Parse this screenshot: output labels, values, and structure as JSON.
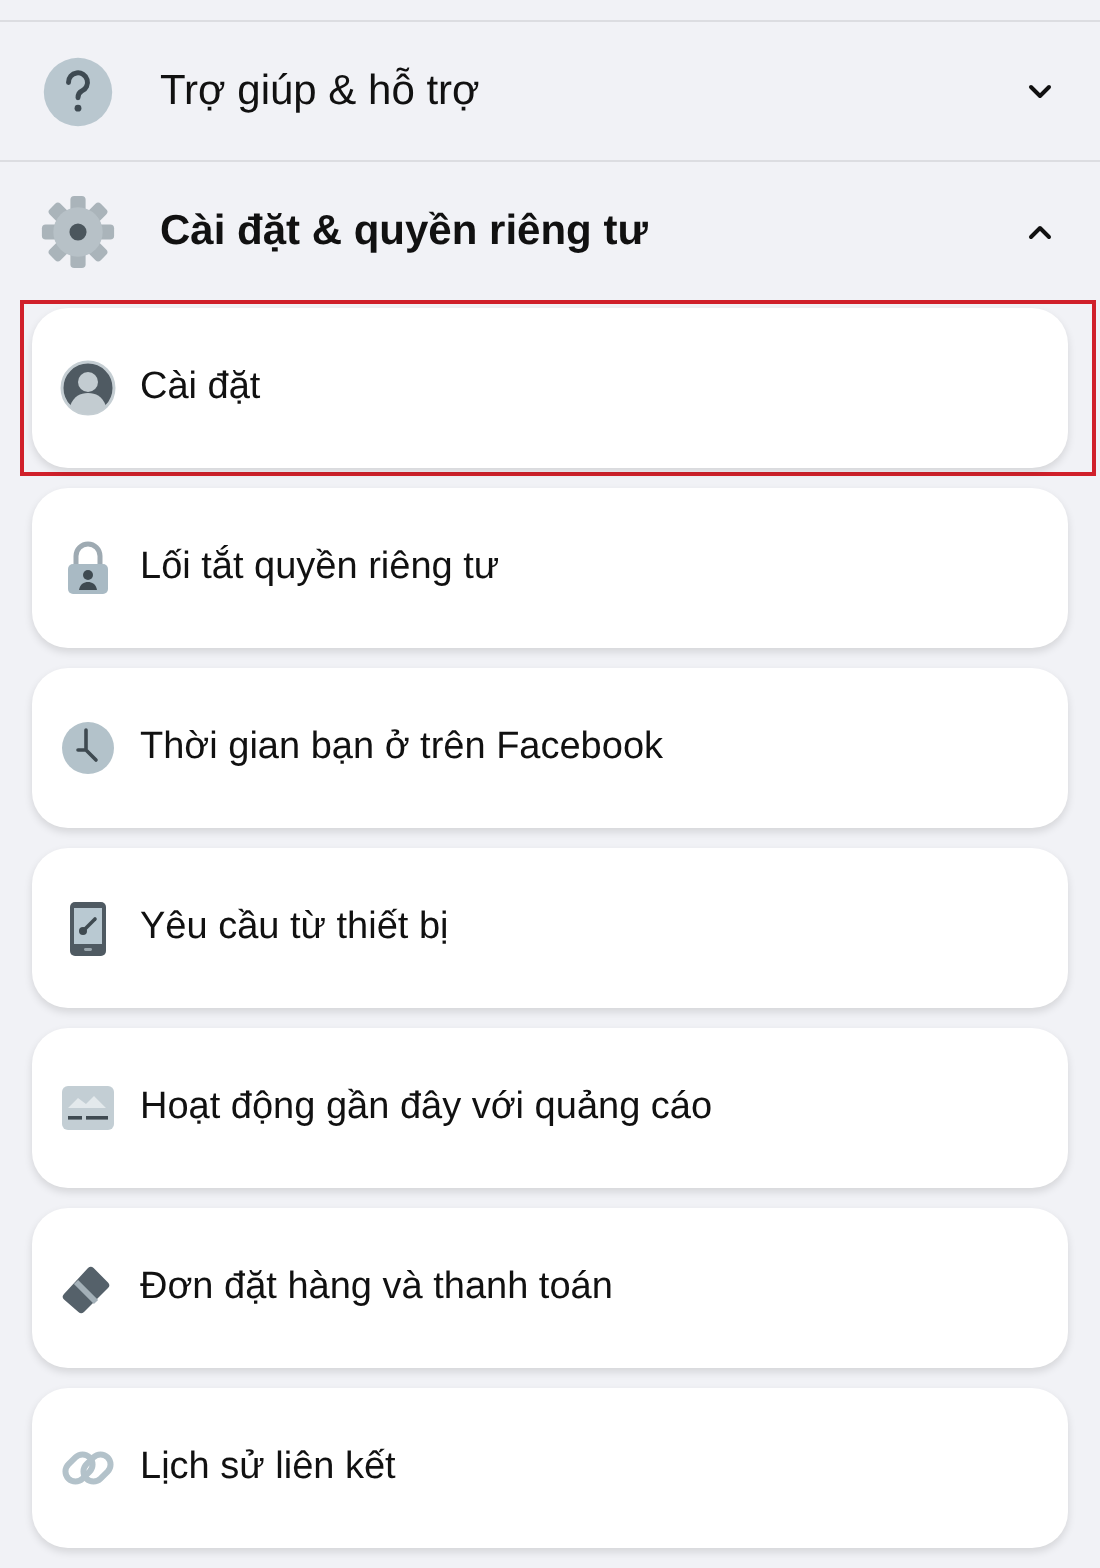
{
  "sections": [
    {
      "title": "Trợ giúp & hỗ trợ",
      "kind": "help",
      "expanded": false
    },
    {
      "title": "Cài đặt & quyền riêng tư",
      "kind": "gear",
      "expanded": true
    }
  ],
  "items": [
    {
      "label": "Cài đặt",
      "kind": "person",
      "highlighted": true
    },
    {
      "label": "Lối tắt quyền riêng tư",
      "kind": "lock",
      "highlighted": false
    },
    {
      "label": "Thời gian bạn ở trên Facebook",
      "kind": "clock",
      "highlighted": false
    },
    {
      "label": "Yêu cầu từ thiết bị",
      "kind": "phone",
      "highlighted": false
    },
    {
      "label": "Hoạt động gần đây với quảng cáo",
      "kind": "ad",
      "highlighted": false
    },
    {
      "label": "Đơn đặt hàng và thanh toán",
      "kind": "card",
      "highlighted": false
    },
    {
      "label": "Lịch sử liên kết",
      "kind": "link",
      "highlighted": false
    }
  ]
}
